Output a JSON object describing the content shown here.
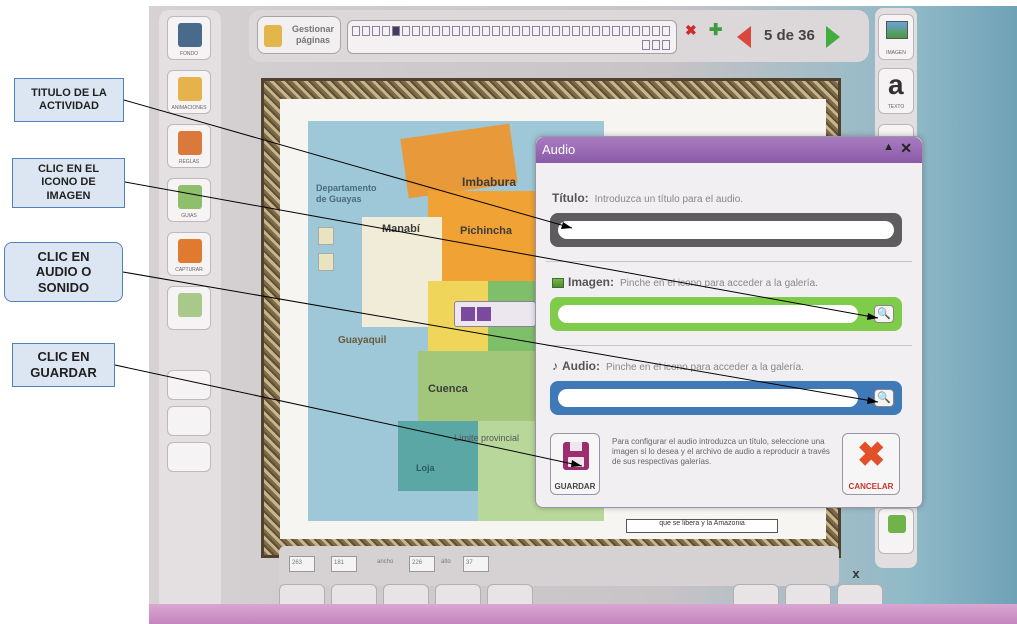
{
  "annotations": [
    {
      "id": "titulo",
      "text": "TITULO DE LA\nACTIVIDAD"
    },
    {
      "id": "imagen",
      "text": "CLIC EN  EL\nICONO DE\nIMAGEN"
    },
    {
      "id": "audio",
      "text": "CLIC EN\nAUDIO O\nSONIDO"
    },
    {
      "id": "guardar",
      "text": "CLIC EN\nGUARDAR"
    }
  ],
  "left_tools": [
    "FONDO",
    "ANIMACIONES",
    "REGLAS",
    "GUIAS",
    "CAPTURAR",
    ""
  ],
  "topbar": {
    "manage_pages": "Gestionar\npáginas",
    "current_page": 5,
    "page_counter": "5 de 36",
    "colors": {
      "prev": "#d9473d",
      "next": "#3fae3f"
    }
  },
  "right_tools": [
    "IMAGEN",
    "TEXTO"
  ],
  "map": {
    "labels": {
      "imbabura": "Imbabura",
      "pichincha": "Pichincha",
      "manabi": "Manabí",
      "guayaquil": "Guayaquil",
      "cuenca": "Cuenca",
      "loja": "Loja",
      "limite": "Límite provincial",
      "legend": "Departamento\nde Guayas"
    },
    "textbox": "que se libera y la Amazonia"
  },
  "dialog": {
    "title": "Audio",
    "titulo_label": "Título:",
    "titulo_hint": "Introduzca un título para el audio.",
    "titulo_value": "",
    "imagen_label": "Imagen:",
    "imagen_hint": "Pinche en el icono para acceder a la galería.",
    "imagen_value": "",
    "audio_label": "Audio:",
    "audio_hint": "Pinche en el icono para acceder a la galería.",
    "audio_value": "",
    "help_text": "Para configurar el audio introduzca un título, seleccione una imagen si lo desea y el archivo de audio a reproducir a través de sus respectivas galerías.",
    "save_label": "GUARDAR",
    "cancel_label": "CANCELAR",
    "colors": {
      "titulo_bar": "#5e5c5e",
      "imagen_bar": "#7fcb4a",
      "audio_bar": "#3f79b8"
    }
  },
  "bottom": {
    "zoom_labels": [
      "263",
      "181",
      "ancho",
      "226",
      "alto",
      "37"
    ],
    "close": "x"
  }
}
